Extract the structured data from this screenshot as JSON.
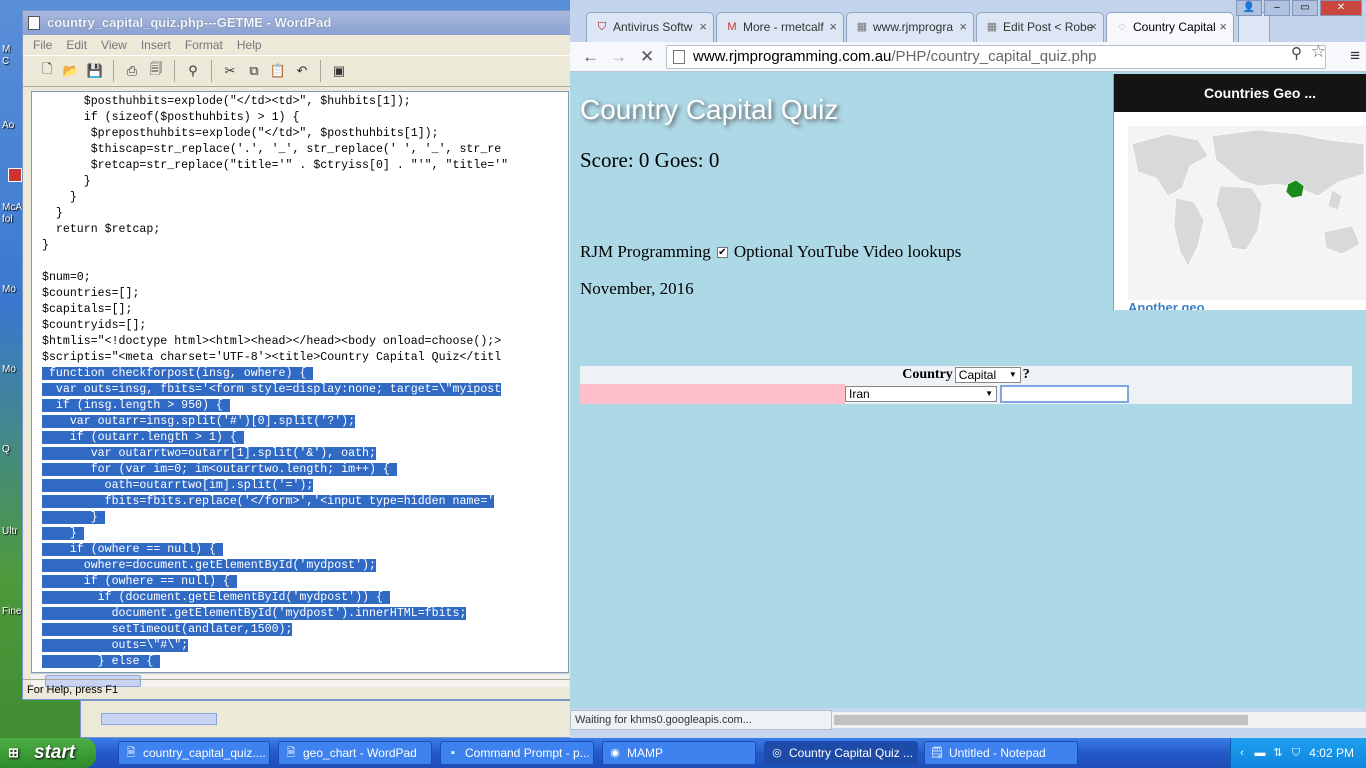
{
  "desktop": {
    "labels": [
      "M",
      "C",
      "Ao",
      "McA",
      "fol",
      "Mo",
      "Mo",
      "Q",
      "Ultr",
      "Fine"
    ]
  },
  "wordpad": {
    "title": "country_capital_quiz.php---GETME - WordPad",
    "menu": [
      "File",
      "Edit",
      "View",
      "Insert",
      "Format",
      "Help"
    ],
    "status": "For Help, press F1",
    "code_lines": [
      "      $posthuhbits=explode(\"</td><td>\", $huhbits[1]);",
      "      if (sizeof($posthuhbits) > 1) {",
      "       $preposthuhbits=explode(\"</td>\", $posthuhbits[1]);",
      "       $thiscap=str_replace('.', '_', str_replace(' ', '_', str_re",
      "       $retcap=str_replace(\"title='\" . $ctryiss[0] . \"'\", \"title='\"",
      "      }",
      "    }",
      "  }",
      "  return $retcap;",
      "}",
      "",
      "$num=0;",
      "$countries=[];",
      "$capitals=[];",
      "$countryids=[];",
      "$htmlis=\"<!doctype html><html><head></head><body onload=choose();>",
      "$scriptis=\"<meta charset='UTF-8'><title>Country Capital Quiz</titl"
    ],
    "selected_lines": [
      " function checkforpost(insg, owhere) { ",
      "  var outs=insg, fbits='<form style=display:none; target=\\\"myipost",
      "  if (insg.length > 950) { ",
      "    var outarr=insg.split('#')[0].split('?');",
      "    if (outarr.length > 1) { ",
      "       var outarrtwo=outarr[1].split('&'), oath;",
      "       for (var im=0; im<outarrtwo.length; im++) { ",
      "         oath=outarrtwo[im].split('=');",
      "         fbits=fbits.replace('</form>','<input type=hidden name='",
      "       } ",
      "    } ",
      "    if (owhere == null) { ",
      "      owhere=document.getElementById('mydpost');",
      "      if (owhere == null) { ",
      "        if (document.getElementById('mydpost')) { ",
      "          document.getElementById('mydpost').innerHTML=fbits;",
      "          setTimeout(andlater,1500);",
      "          outs=\\\"#\\\";",
      "        } else { "
    ]
  },
  "chrome": {
    "tabs": [
      {
        "label": "Antivirus Softw",
        "icon": "mcafee-icon"
      },
      {
        "label": "More - rmetcalf",
        "icon": "gmail-icon"
      },
      {
        "label": "www.rjmprogra",
        "icon": "rjm-icon"
      },
      {
        "label": "Edit Post < Robe",
        "icon": "wordpress-icon"
      },
      {
        "label": "Country Capital",
        "icon": "loading-icon"
      }
    ],
    "url_host": "www.rjmprogramming.com.au",
    "url_path": "/PHP/country_capital_quiz.php",
    "status": "Waiting for khms0.googleapis.com..."
  },
  "quiz": {
    "title": "Country Capital Quiz",
    "score": "Score: 0 Goes: 0",
    "brand": "RJM Programming",
    "checkbox_checked": true,
    "youtube_label": "Optional YouTube Video lookups",
    "date": "November, 2016",
    "geo_header": "Countries Geo ...",
    "geo_link": "Another geo",
    "head_country": "Country",
    "head_mode_selected": "Capital",
    "head_question": "?",
    "country_selected": "Iran",
    "answer_value": "",
    "highlight_color": "#1a8a1a"
  },
  "taskbar": {
    "start": "start",
    "items": [
      {
        "label": "country_capital_quiz....",
        "icon": "wordpad-icon"
      },
      {
        "label": "geo_chart - WordPad",
        "icon": "wordpad-icon"
      },
      {
        "label": "Command Prompt - p...",
        "icon": "cmd-icon"
      },
      {
        "label": "MAMP",
        "icon": "mamp-icon"
      },
      {
        "label": "Country Capital Quiz ...",
        "icon": "chrome-icon"
      },
      {
        "label": "Untitled - Notepad",
        "icon": "notepad-icon"
      }
    ],
    "clock": "4:02 PM"
  }
}
